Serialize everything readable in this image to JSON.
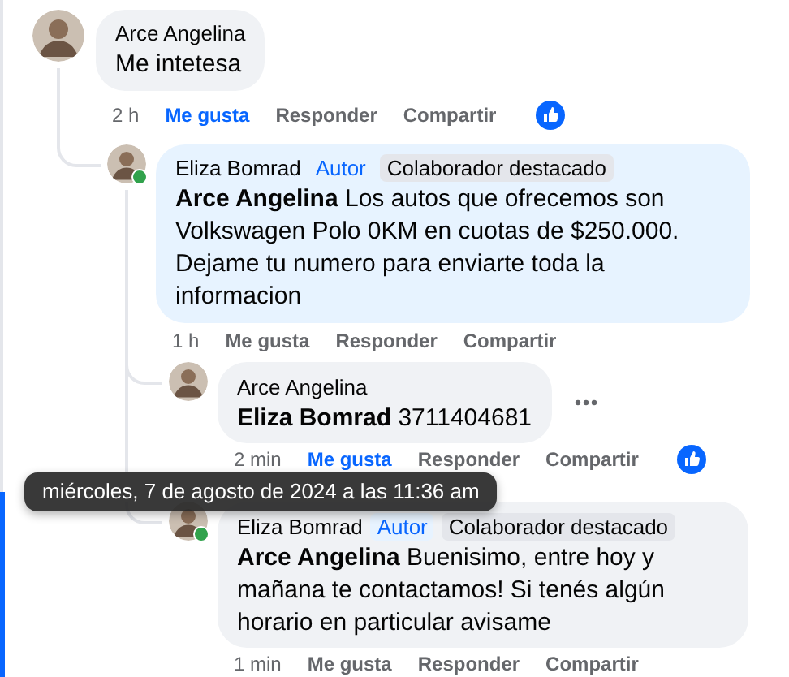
{
  "comments": [
    {
      "author": "Arce Angelina",
      "text": "Me intetesa",
      "time": "2 h",
      "like_label": "Me gusta",
      "liked": true,
      "reply_label": "Responder",
      "share_label": "Compartir",
      "has_reactions": true,
      "children": [
        {
          "author": "Eliza Bomrad",
          "text": "**Arce Angelina** Los autos que ofrecemos son Volkswagen Polo 0KM en cuotas de $250.000. Dejame tu numero para enviarte toda la informacion",
          "online": true,
          "highlighted": true,
          "badges": [
            {
              "label": "Autor",
              "kind": "author"
            },
            {
              "label": "Colaborador destacado",
              "kind": "top_fan"
            }
          ],
          "time": "1 h",
          "like_label": "Me gusta",
          "liked": false,
          "reply_label": "Responder",
          "share_label": "Compartir",
          "children": [
            {
              "author": "Arce Angelina",
              "text": "**Eliza Bomrad** 3711404681",
              "highlighted": false,
              "time": "2 min",
              "like_label": "Me gusta",
              "liked": true,
              "reply_label": "Responder",
              "share_label": "Compartir",
              "has_reactions": true,
              "more_button": true
            },
            {
              "author": "Eliza Bomrad",
              "text": "**Arce Angelina** Buenisimo, entre hoy y mañana te contactamos! Si tenés algún horario en particular avisame",
              "online": true,
              "highlighted": false,
              "badges": [
                {
                  "label": "Autor",
                  "kind": "author"
                },
                {
                  "label": "Colaborador destacado",
                  "kind": "top_fan"
                }
              ],
              "time": "1 min",
              "like_label": "Me gusta",
              "liked": false,
              "reply_label": "Responder",
              "share_label": "Compartir"
            }
          ]
        }
      ]
    }
  ],
  "tooltip": {
    "text": "miércoles, 7 de agosto de 2024 a las 11:36 am"
  }
}
